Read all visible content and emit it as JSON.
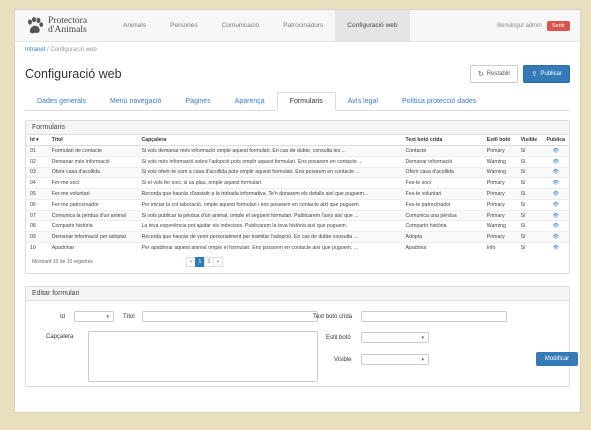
{
  "nav": {
    "logo_line1": "Protectora",
    "logo_line2": "d'Animals",
    "items": [
      "Animals",
      "Persones",
      "Comunicació",
      "Patrocinadors",
      "Configuració web"
    ],
    "welcome": "Benvingut admin",
    "exit": "Sortir"
  },
  "breadcrumb": {
    "home": "Intranet",
    "sep": "/",
    "current": "Configuració web"
  },
  "page": {
    "title": "Configuració web",
    "restore": "Restablir",
    "publish": "Publicar"
  },
  "tabs": [
    "Dades generals",
    "Menú navegació",
    "Pàgines",
    "Aparença",
    "Formularis",
    "Avís legal",
    "Política protecció dades"
  ],
  "forms_panel": {
    "title": "Formularis",
    "headers": [
      "Id",
      "Títol",
      "Capçalera",
      "Text botó crida",
      "Estil botó",
      "Visible",
      "Publica"
    ],
    "rows": [
      {
        "id": "01",
        "title": "Formulari de contacte",
        "header": "Si vols demanar més informació omple aquest formulari. En cas de dubte, consulta les ...",
        "cta": "Contacte",
        "style": "Primary",
        "visible": "Sí"
      },
      {
        "id": "02",
        "title": "Demanar més informació",
        "header": "Si vols més informació sobre l'adopció pots omplir aquest formulari. Ens posarem en contacte ...",
        "cta": "Demanar informació",
        "style": "Warning",
        "visible": "Sí"
      },
      {
        "id": "03",
        "title": "Oferir casa d'acollida",
        "header": "Si vols oferir-te com a casa d'acollida pots omplir aquest formulari. Ens posarem en contacte ...",
        "cta": "Oferir casa d'acollida",
        "style": "Warning",
        "visible": "Sí"
      },
      {
        "id": "04",
        "title": "Fer-me soci",
        "header": "Si et vols fer soci, si us plau, omple aquest formulari.",
        "cta": "Fes-te soci",
        "style": "Primary",
        "visible": "Sí"
      },
      {
        "id": "05",
        "title": "Fer-me voluntari",
        "header": "Recorda que hauràs d'assistir a la trobada informativa. Te'n donarem els detalls així que puguem...",
        "cta": "Fes-te voluntari",
        "style": "Primary",
        "visible": "Sí"
      },
      {
        "id": "06",
        "title": "Fer-me patrocinador",
        "header": "Per iniciar la col·laboració, omple aquest formulari i ens posarem en contacte així que puguem.",
        "cta": "Fes-te patrocinador",
        "style": "Primary",
        "visible": "Sí"
      },
      {
        "id": "07",
        "title": "Comunica la pèrdua d'un animal",
        "header": "Si vols publicar la pèrdua d'un animal, omple el següent formulari. Publicarem l'avís així que ...",
        "cta": "Comunica una pèrdua",
        "style": "Primary",
        "visible": "Sí"
      },
      {
        "id": "08",
        "title": "Compartir història",
        "header": "La teva experiència pot ajudar els indecisos. Publicarem la teva història així que puguem.",
        "cta": "Compartir història",
        "style": "Warning",
        "visible": "Sí"
      },
      {
        "id": "09",
        "title": "Demanar informació per adoptar",
        "header": "Recorda que hauràs de venir personalment per tramitar l'adopció. En cas de dubte consulta ...",
        "cta": "Adopta",
        "style": "Primary",
        "visible": "Sí"
      },
      {
        "id": "10",
        "title": "Apadrinar",
        "header": "Per apadrinar aquest animal omple el formulari. Ens posarem en contacte així que puguem. ...",
        "cta": "Apadrina",
        "style": "Info",
        "visible": "Sí"
      }
    ],
    "records": "Mostrant 10 de 10 registres",
    "pagination": [
      "«",
      "1",
      "2",
      "»"
    ]
  },
  "edit_panel": {
    "title": "Editar formulari",
    "id_label": "Id",
    "title_label": "Títol",
    "header_label": "Capçalera",
    "cta_label": "Text botó crida",
    "style_label": "Estil botó",
    "visible_label": "Visible",
    "submit": "Modificar"
  },
  "colors": {
    "primary": "#337ab7",
    "danger": "#d9534f",
    "background": "#e9dfbf"
  }
}
